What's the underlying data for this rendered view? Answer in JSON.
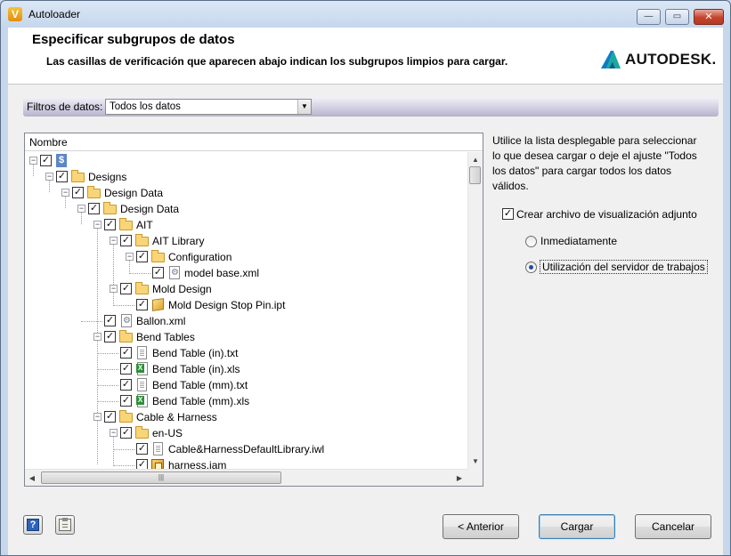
{
  "window": {
    "title": "Autoloader",
    "app_icon": "V",
    "controls": {
      "minimize": "—",
      "maximize": "▭",
      "close": "✕"
    }
  },
  "header": {
    "title": "Especificar subgrupos de datos",
    "subtitle": "Las casillas de verificación que aparecen abajo indican los subgrupos limpios para cargar.",
    "logo_text": "AUTODESK."
  },
  "filter": {
    "label": "Filtros de datos:",
    "selected": "Todos los datos"
  },
  "tree": {
    "column_header": "Nombre",
    "items": [
      {
        "label": "$",
        "icon": "vault-root-icon",
        "checked": true,
        "expanded": true
      },
      {
        "label": "Designs",
        "icon": "folder-icon",
        "checked": true,
        "expanded": true
      },
      {
        "label": "Design Data",
        "icon": "folder-icon",
        "checked": true,
        "expanded": true
      },
      {
        "label": "Design Data",
        "icon": "folder-icon",
        "checked": true,
        "expanded": true
      },
      {
        "label": "AIT",
        "icon": "folder-icon",
        "checked": true,
        "expanded": true
      },
      {
        "label": "AIT Library",
        "icon": "folder-icon",
        "checked": true,
        "expanded": true
      },
      {
        "label": "Configuration",
        "icon": "folder-icon",
        "checked": true,
        "expanded": true
      },
      {
        "label": "model base.xml",
        "icon": "xml-file-icon",
        "checked": true
      },
      {
        "label": "Mold Design",
        "icon": "folder-icon",
        "checked": true,
        "expanded": true
      },
      {
        "label": "Mold Design Stop Pin.ipt",
        "icon": "ipt-part-icon",
        "checked": true
      },
      {
        "label": "Ballon.xml",
        "icon": "xml-file-icon",
        "checked": true
      },
      {
        "label": "Bend Tables",
        "icon": "folder-icon",
        "checked": true,
        "expanded": true
      },
      {
        "label": "Bend Table (in).txt",
        "icon": "text-file-icon",
        "checked": true
      },
      {
        "label": "Bend Table (in).xls",
        "icon": "excel-file-icon",
        "checked": true
      },
      {
        "label": "Bend Table (mm).txt",
        "icon": "text-file-icon",
        "checked": true
      },
      {
        "label": "Bend Table (mm).xls",
        "icon": "excel-file-icon",
        "checked": true
      },
      {
        "label": "Cable & Harness",
        "icon": "folder-icon",
        "checked": true,
        "expanded": true
      },
      {
        "label": "en-US",
        "icon": "folder-icon",
        "checked": true,
        "expanded": true
      },
      {
        "label": "Cable&HarnessDefaultLibrary.iwl",
        "icon": "text-file-icon",
        "checked": true
      },
      {
        "label": "harness.iam",
        "icon": "iam-assembly-icon",
        "checked": true
      }
    ]
  },
  "info": {
    "text": "Utilice la lista desplegable para seleccionar lo que desea cargar o deje el ajuste \"Todos los datos\" para cargar todos los datos válidos."
  },
  "options": {
    "create_visualization_label": "Crear archivo de visualización adjunto",
    "create_visualization_checked": true,
    "radio_immediate": "Inmediatamente",
    "radio_job_server": "Utilización del servidor de trabajos",
    "selected_radio": "job_server"
  },
  "buttons": {
    "back": "< Anterior",
    "load": "Cargar",
    "cancel": "Cancelar"
  },
  "colors": {
    "accent_blue": "#1f4ea0",
    "filter_bar": "#c9c6db",
    "window_frame": "#c6d7ec"
  }
}
